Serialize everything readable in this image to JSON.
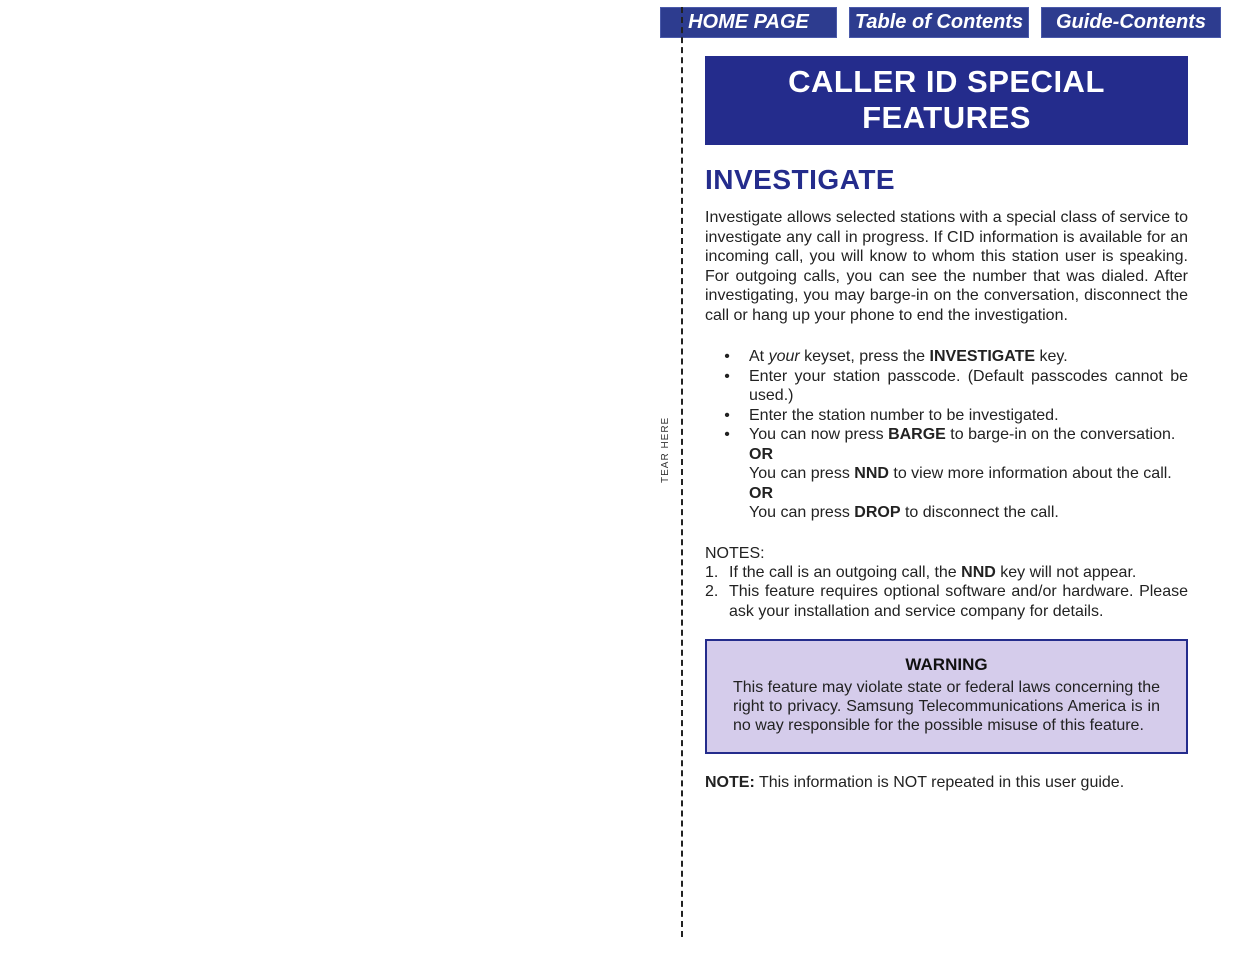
{
  "nav": {
    "home": "HOME PAGE",
    "toc": "Table of Contents",
    "guide": "Guide-Contents"
  },
  "tear_label": "TEAR HERE",
  "banner": "CALLER ID SPECIAL FEATURES",
  "section_title": "INVESTIGATE",
  "intro": "Investigate allows selected stations with a special class of service to investigate any call in progress. If CID information is available for an incoming call, you will know to whom this station user is speaking. For outgoing calls, you can see the number that was dialed. After investigating, you may barge-in on the conversation, disconnect the call or hang up your phone to end the investigation.",
  "steps": {
    "s1_pre": "At ",
    "s1_your": "your",
    "s1_mid": " keyset, press the ",
    "s1_key": "INVESTIGATE",
    "s1_post": " key.",
    "s2": "Enter your station passcode. (Default passcodes cannot be used.)",
    "s3": "Enter the station number to be investigated.",
    "s4_pre": "You can now press ",
    "s4_key": "BARGE",
    "s4_post": " to barge-in on the conversation.",
    "or": "OR",
    "s5_pre": "You can press ",
    "s5_key": "NND",
    "s5_post": " to view more information about the call.",
    "s6_pre": "You can press ",
    "s6_key": "DROP",
    "s6_post": " to disconnect the call."
  },
  "notes_label": "NOTES:",
  "notes": {
    "n1_pre": "If the call is an outgoing call, the ",
    "n1_key": "NND",
    "n1_post": " key will not appear.",
    "n2": "This feature requires optional software and/or hardware. Please ask your installation and service company for details."
  },
  "warning": {
    "title": "WARNING",
    "text": "This feature may violate state or federal laws concerning the right to privacy. Samsung Telecommunications America is in no way responsible for the possible misuse of this feature."
  },
  "final_note_bold": "NOTE:",
  "final_note_text": " This information is NOT repeated in this user guide."
}
